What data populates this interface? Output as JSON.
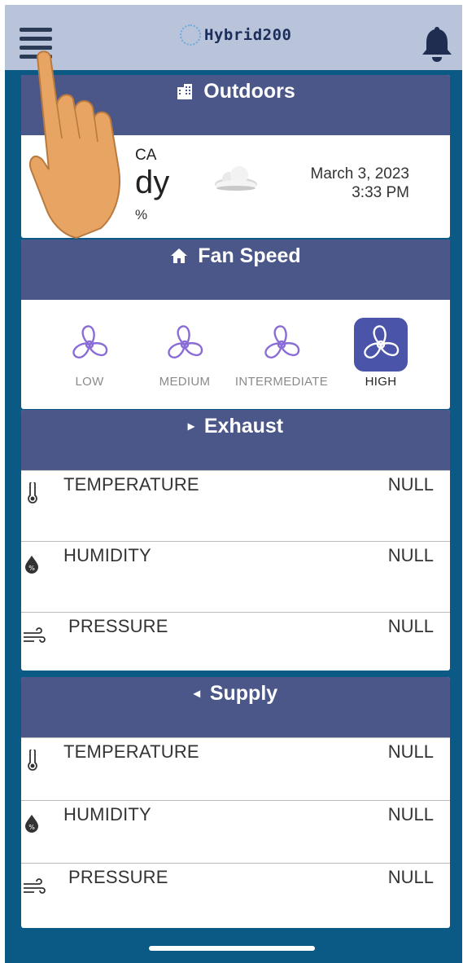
{
  "app": {
    "title": "Hybrid200"
  },
  "outdoors": {
    "title": "Outdoors",
    "location": "CA",
    "condition": "dy",
    "humidity": "%",
    "date": "March 3, 2023",
    "time": "3:33 PM"
  },
  "fan": {
    "title": "Fan Speed",
    "options": [
      {
        "label": "LOW"
      },
      {
        "label": "MEDIUM"
      },
      {
        "label": "INTERMEDIATE"
      },
      {
        "label": "HIGH"
      }
    ],
    "selected": "HIGH"
  },
  "exhaust": {
    "title": "Exhaust",
    "rows": [
      {
        "label": "TEMPERATURE",
        "value": "NULL",
        "icon": "thermometer-icon"
      },
      {
        "label": "HUMIDITY",
        "value": "NULL",
        "icon": "humidity-drop-icon"
      },
      {
        "label": "PRESSURE",
        "value": "NULL",
        "icon": "wind-icon"
      }
    ]
  },
  "supply": {
    "title": "Supply",
    "rows": [
      {
        "label": "TEMPERATURE",
        "value": "NULL",
        "icon": "thermometer-icon"
      },
      {
        "label": "HUMIDITY",
        "value": "NULL",
        "icon": "humidity-drop-icon"
      },
      {
        "label": "PRESSURE",
        "value": "NULL",
        "icon": "wind-icon"
      }
    ]
  },
  "colors": {
    "background": "#0b5a86",
    "topbar": "#b9c4da",
    "section_header": "#4b5788",
    "fan_selected": "#4a54a8",
    "fan_icon": "#8a6cd6"
  }
}
